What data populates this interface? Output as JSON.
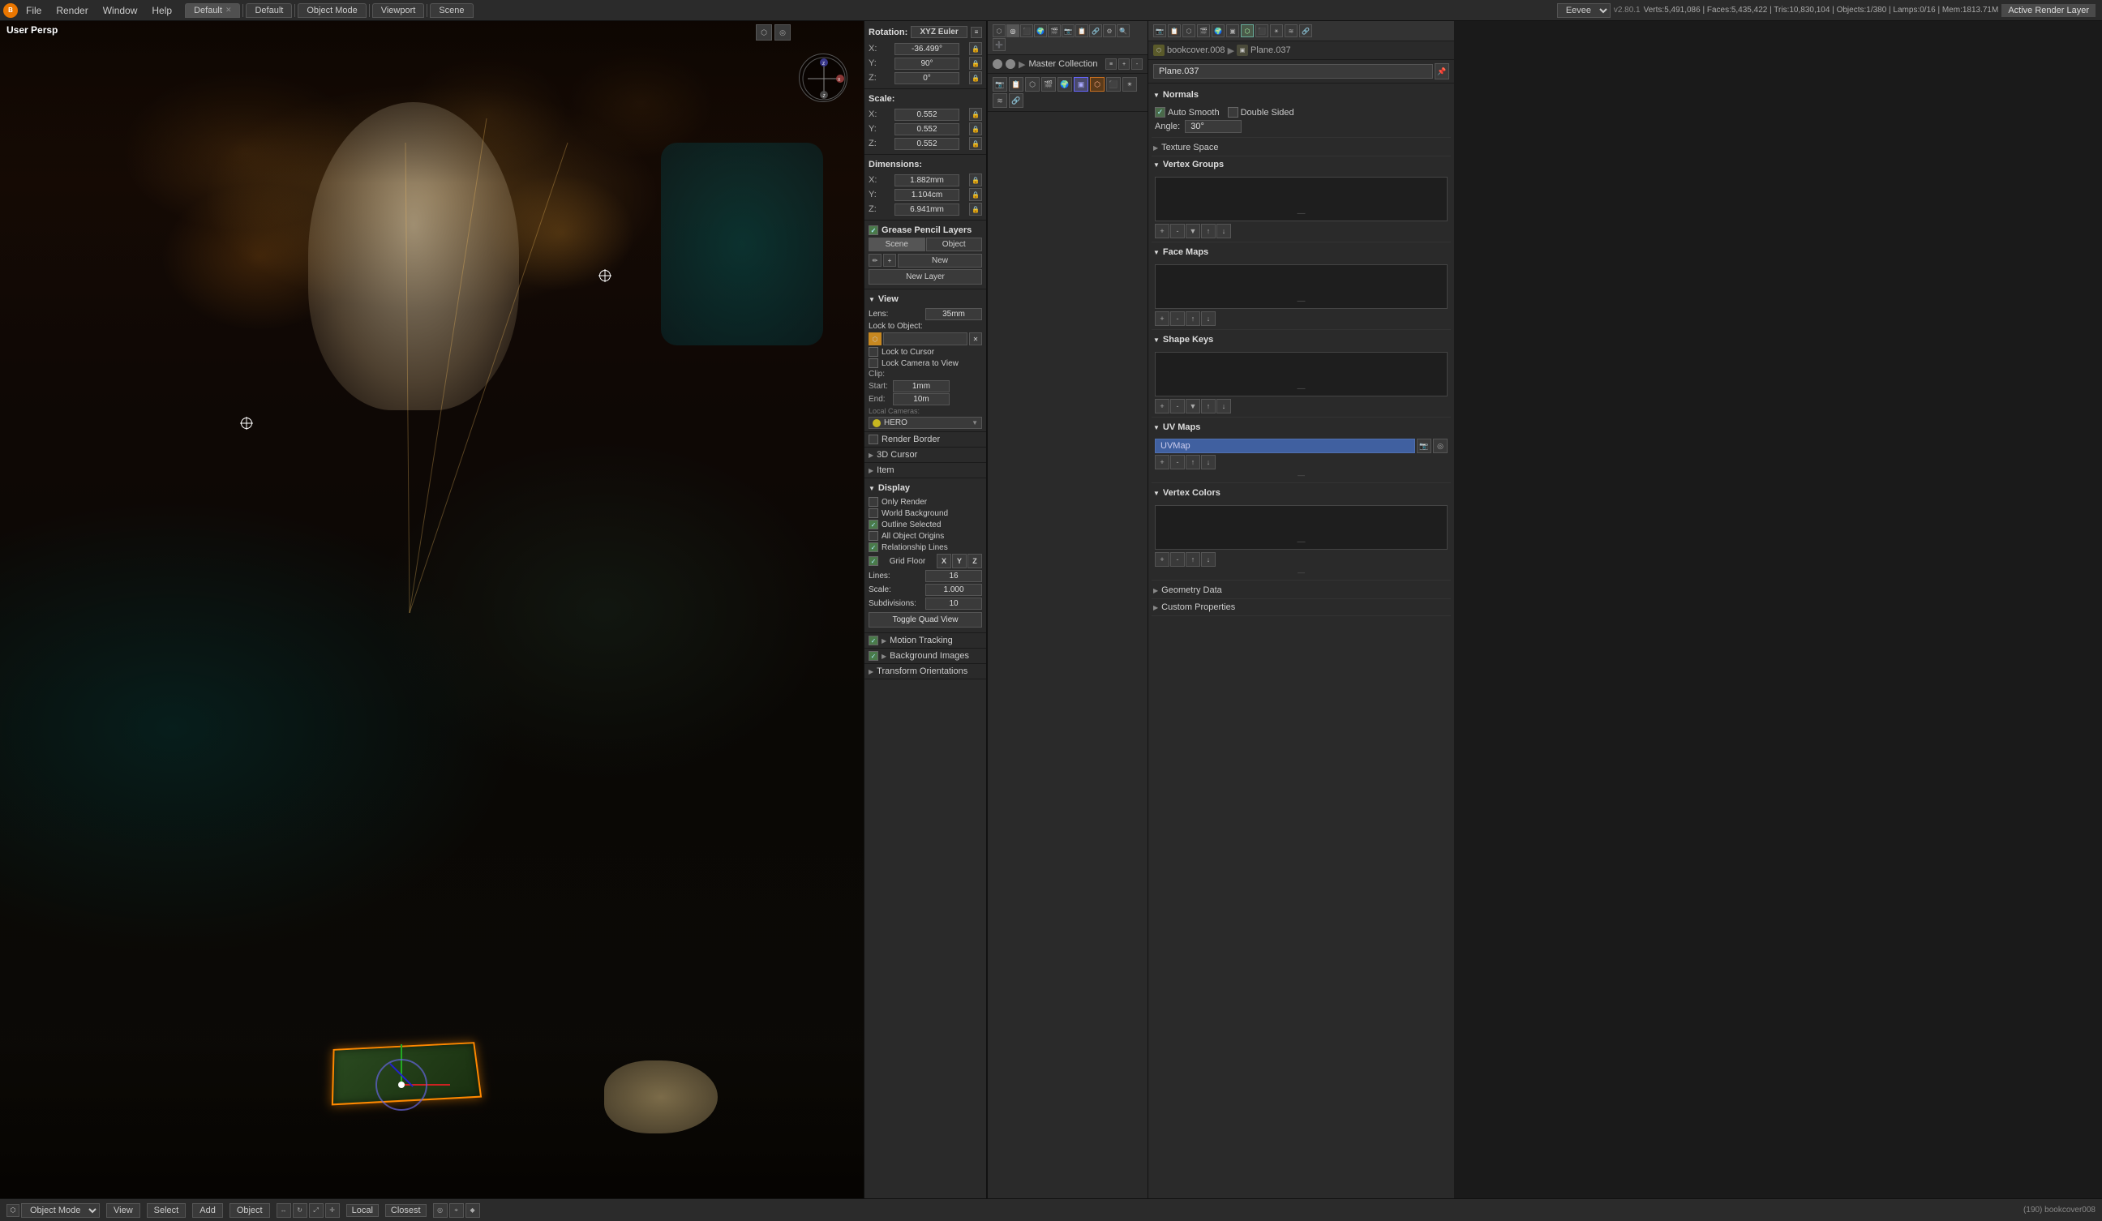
{
  "topbar": {
    "logo": "B",
    "menu": [
      "File",
      "Render",
      "Window",
      "Help"
    ],
    "workspaces": [
      {
        "label": "Default",
        "active": true
      },
      {
        "label": "Default",
        "active": false
      },
      {
        "label": "Object Mode",
        "active": false
      },
      {
        "label": "Viewport",
        "active": false
      },
      {
        "label": "Scene",
        "active": false
      }
    ],
    "engine": "Eevee",
    "version": "v2.80.1",
    "stats": "Verts:5,491,086 | Faces:5,435,422 | Tris:10,830,104 | Objects:1/380 | Lamps:0/16 | Mem:1813.71M",
    "active_render_layer": "Active Render Layer"
  },
  "viewport": {
    "label": "User Persp",
    "object_info": "(190) bookcover008"
  },
  "properties": {
    "rotation_label": "Rotation:",
    "xyz_euler": "XYZ Euler",
    "rotation": {
      "x_label": "X:",
      "x_value": "-36.499°",
      "y_label": "Y:",
      "y_value": "90°",
      "z_label": "Z:",
      "z_value": "0°"
    },
    "scale_label": "Scale:",
    "scale": {
      "x_label": "X:",
      "x_value": "0.552",
      "y_label": "Y:",
      "y_value": "0.552",
      "z_label": "Z:",
      "z_value": "0.552"
    },
    "dimensions_label": "Dimensions:",
    "dimensions": {
      "x_label": "X:",
      "x_value": "1.882mm",
      "y_label": "Y:",
      "y_value": "1.104cm",
      "z_label": "Z:",
      "z_value": "6.941mm"
    },
    "grease_pencil": {
      "title": "Grease Pencil Layers",
      "tabs": [
        "Scene",
        "Object"
      ],
      "new_label": "New",
      "new_layer_label": "New Layer"
    },
    "view": {
      "title": "View",
      "lens_label": "Lens:",
      "lens_value": "35mm",
      "lock_to_object": "Lock to Object:",
      "lock_cursor": "Lock to Cursor",
      "lock_camera": "Lock Camera to View",
      "clip_label": "Clip:",
      "start_label": "Start:",
      "start_value": "1mm",
      "end_label": "End:",
      "end_value": "10m",
      "local_cameras": "Local Cameras:",
      "hero_label": "HERO",
      "render_border": "Render Border",
      "cursor_3d": "3D Cursor"
    },
    "item": {
      "title": "Item"
    },
    "display": {
      "title": "Display",
      "only_render": "Only Render",
      "world_background": "World Background",
      "outline_selected": "Outline Selected",
      "all_object_origins": "All Object Origins",
      "relationship_lines": "Relationship Lines",
      "grid_floor": "Grid Floor",
      "lines_label": "Lines:",
      "lines_value": "16",
      "scale_label": "Scale:",
      "scale_value": "1.000",
      "subdivisions_label": "Subdivisions:",
      "subdivisions_value": "10",
      "toggle_quad": "Toggle Quad View",
      "xyz_buttons": [
        "X",
        "Y",
        "Z"
      ]
    },
    "motion_tracking": "Motion Tracking",
    "background_images": "Background Images",
    "transform_orientations": "Transform Orientations"
  },
  "collection": {
    "title": "Master Collection",
    "icons": [
      "🔍",
      "⚙",
      "📋",
      "🎬",
      "🔗",
      "🌍",
      "📷",
      "✋",
      "⬡",
      "🎨",
      "🔧",
      "➕",
      "⬛"
    ]
  },
  "right_panel": {
    "breadcrumb": {
      "collection": "bookcover.008",
      "sep": "▶",
      "object": "Plane.037"
    },
    "plane_name": "Plane.037",
    "normals": {
      "title": "Normals",
      "auto_smooth": "Auto Smooth",
      "double_sided": "Double Sided",
      "angle_label": "Angle:",
      "angle_value": "30°"
    },
    "texture_space": {
      "title": "Texture Space"
    },
    "vertex_groups": {
      "title": "Vertex Groups"
    },
    "face_maps": {
      "title": "Face Maps"
    },
    "shape_keys": {
      "title": "Shape Keys"
    },
    "uv_maps": {
      "title": "UV Maps",
      "entry": "UVMap"
    },
    "vertex_colors": {
      "title": "Vertex Colors"
    },
    "geometry_data": {
      "title": "Geometry Data"
    },
    "custom_properties": {
      "title": "Custom Properties"
    }
  },
  "bottom_bar": {
    "mode": "Object Mode",
    "view": "View",
    "select": "Select",
    "add": "Add",
    "object": "Object",
    "snap": "Local",
    "snap_to": "Closest"
  }
}
